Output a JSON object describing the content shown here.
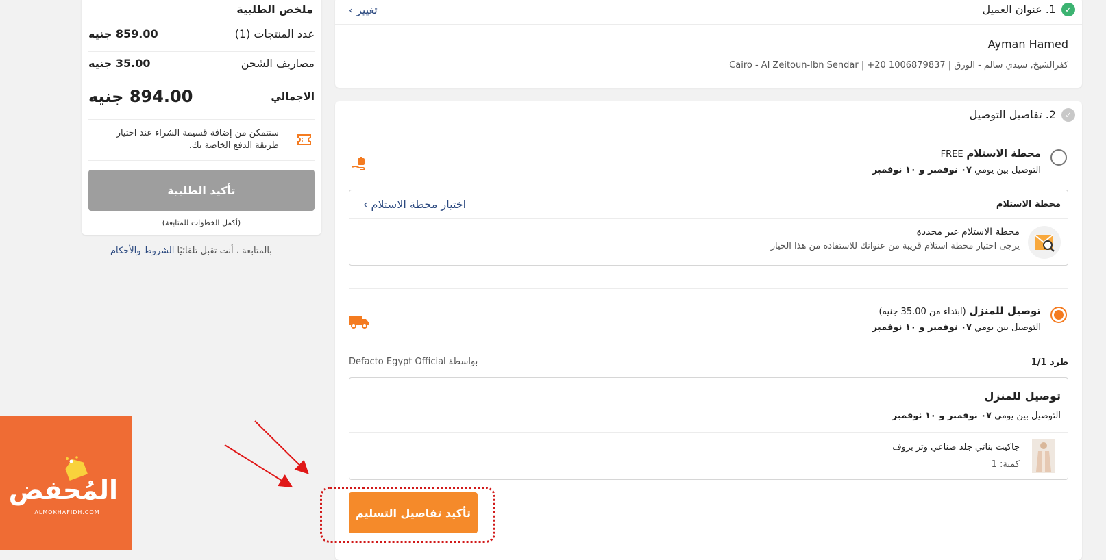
{
  "summary": {
    "title": "ملخص الطلبية",
    "items_label": "عدد المنتجات (1)",
    "items_value": "859.00 جنيه",
    "shipping_label": "مصاريف الشحن",
    "shipping_value": "35.00 جنيه",
    "total_label": "الاجمالي",
    "total_value": "894.00 جنيه",
    "installment_note": "ستتمكن من إضافة قسيمة الشراء عند اختيار طريقة الدفع الخاصة بك.",
    "confirm_order_label": "تأكيد الطلبية",
    "complete_steps_note": "(أكمل الخطوات للمتابعة)",
    "terms_prefix": "بالمتابعة ، أنت تقبل تلقائيًا",
    "terms_link": "الشروط والأحكام"
  },
  "address": {
    "step_title": "1. عنوان العميل",
    "change_label": "تغيير",
    "name": "Ayman Hamed",
    "details": "كفرالشيخ, سيدي سالم - الورق | 1006879837 20+ | Cairo - Al Zeitoun-Ibn Sendar"
  },
  "delivery": {
    "step_title": "2. تفاصيل التوصيل",
    "pickup": {
      "title": "محطة الاستلام",
      "badge": "FREE",
      "dates_prefix": "التوصيل بين يومي",
      "dates_bold": "٠٧ نوفمبر و ١٠ نوفمبر",
      "box_header": "محطة الاستلام",
      "choose_link": "اختيار محطة الاستلام",
      "not_set": "محطة الاستلام غير محددة",
      "hint": "يرجى اختيار محطة استلام قريبة من عنوانك للاستفادة من هذا الخيار"
    },
    "home": {
      "title": "توصيل للمنزل",
      "price_note": "(ابتداء من 35.00 جنيه)",
      "dates_prefix": "التوصيل بين يومي",
      "dates_bold": "٠٧ نوفمبر و ١٠ نوفمبر",
      "parcel_label": "طرد 1/1",
      "seller": "بواسطة Defacto Egypt Official",
      "box_title": "توصيل للمنزل",
      "product_name": "جاكيت بناتي جلد صناعي وتر بروف",
      "quantity": "كمية: 1"
    },
    "confirm_label": "تأكيد تفاصيل التسليم"
  },
  "watermark": {
    "brand": "المُحفض",
    "domain": "ALMOKHAFIDH.COM"
  },
  "colors": {
    "accent": "#f58a2a",
    "success": "#3cb371",
    "link": "#2c4a80",
    "annotation": "#d11a1a",
    "logo_bg": "#ef6c34"
  }
}
